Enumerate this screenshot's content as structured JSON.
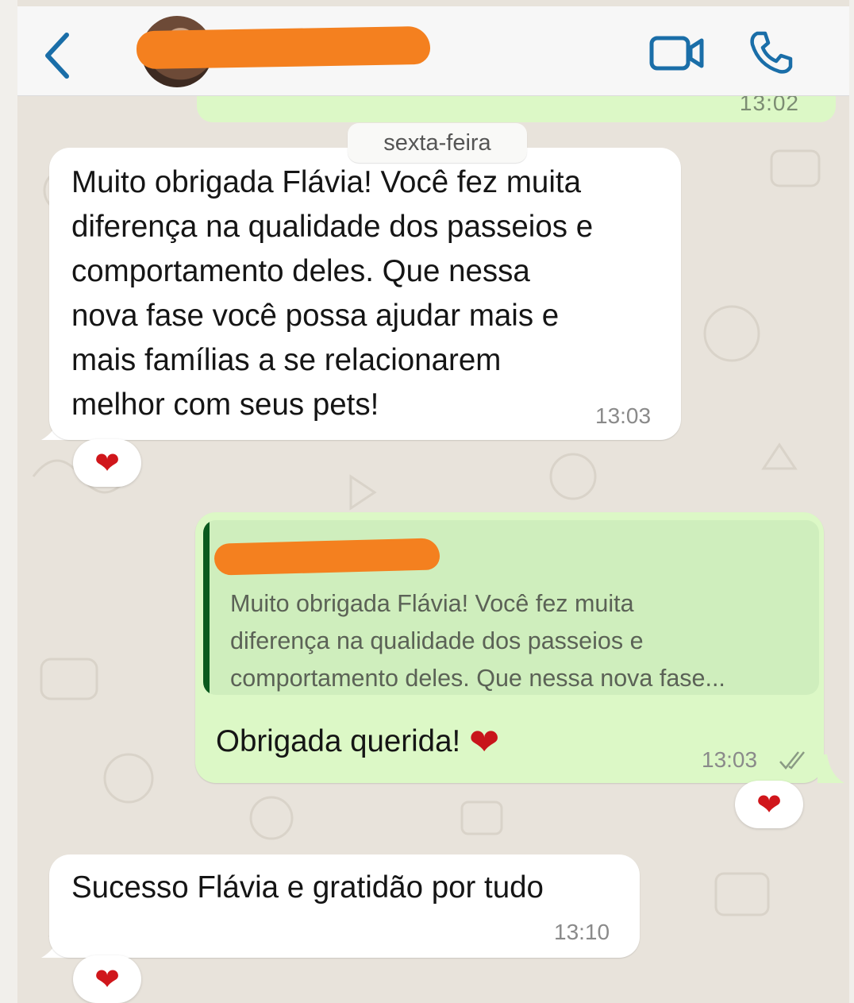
{
  "header": {
    "contact_name": "",
    "back_icon": "chevron-left-icon",
    "video_icon": "video-camera-icon",
    "call_icon": "phone-icon",
    "accent_color": "#1a6ea8"
  },
  "chat": {
    "previous_message_time": "13:02",
    "date_separator": "sexta-feira",
    "messages": [
      {
        "direction": "incoming",
        "lines": [
          "Muito obrigada Flávia! Você fez muita",
          "diferença na qualidade dos passeios e",
          "comportamento deles. Que nessa",
          "nova fase você possa ajudar mais e",
          "mais famílias a se relacionarem",
          "melhor com seus pets!"
        ],
        "time": "13:03",
        "reaction": "❤"
      },
      {
        "direction": "outgoing",
        "quote": {
          "sender": "",
          "lines": [
            "Muito obrigada Flávia! Você fez muita",
            "diferença na qualidade dos passeios e",
            "comportamento deles. Que nessa nova fase..."
          ]
        },
        "text": "Obrigada querida!",
        "emoji": "❤",
        "time": "13:03",
        "status_icon": "double-check-icon",
        "reaction": "❤"
      },
      {
        "direction": "incoming",
        "text": "Sucesso Flávia e gratidão por tudo",
        "time": "13:10",
        "reaction": "❤"
      }
    ]
  }
}
